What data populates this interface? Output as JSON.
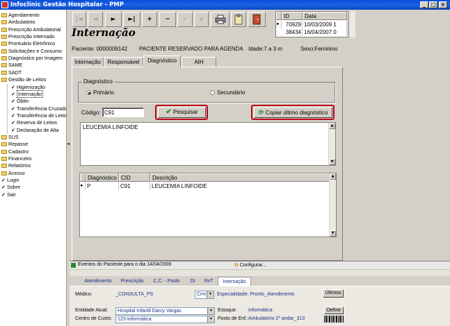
{
  "window": {
    "title": "Infoclinic Gestão Hospitalar - PMP",
    "min": "_",
    "max": "□",
    "close": "×"
  },
  "sidebar": {
    "items": [
      {
        "label": "Agendamento",
        "type": "folder"
      },
      {
        "label": "Ambulatório",
        "type": "folder"
      },
      {
        "label": "Prescrição Ambulatorial",
        "type": "folder"
      },
      {
        "label": "Prescrição Internado",
        "type": "folder"
      },
      {
        "label": "Prontuário Eletrônico",
        "type": "folder"
      },
      {
        "label": "Solicitações e Consumo",
        "type": "folder"
      },
      {
        "label": "Diagnóstico por Imagem",
        "type": "folder"
      },
      {
        "label": "SAME",
        "type": "folder"
      },
      {
        "label": "SADT",
        "type": "folder"
      },
      {
        "label": "Gestão de Leitos",
        "type": "folder-open"
      },
      {
        "label": "Higienização",
        "type": "child"
      },
      {
        "label": "Internação",
        "type": "child-selected"
      },
      {
        "label": "Óbito",
        "type": "child"
      },
      {
        "label": "Transferência Cruzada",
        "type": "child"
      },
      {
        "label": "Transferência de Leito",
        "type": "child"
      },
      {
        "label": "Reserva de Leitos",
        "type": "child"
      },
      {
        "label": "Declaração de Alta",
        "type": "child"
      },
      {
        "label": "SUS",
        "type": "folder"
      },
      {
        "label": "Repasse",
        "type": "folder"
      },
      {
        "label": "Cadastro",
        "type": "folder"
      },
      {
        "label": "Financeiro",
        "type": "folder"
      },
      {
        "label": "Relatórios",
        "type": "folder"
      },
      {
        "label": "Acesso",
        "type": "folder"
      },
      {
        "label": "Login",
        "type": "check"
      },
      {
        "label": "Sobre",
        "type": "check"
      },
      {
        "label": "Sair",
        "type": "check"
      }
    ]
  },
  "toolbar": {
    "first": "|◄",
    "prev": "◄",
    "next": "►",
    "last": "►|",
    "add": "+",
    "remove": "−",
    "confirm": "✓",
    "cancel": "×"
  },
  "record_grid": {
    "headers": [
      "ID",
      "Data"
    ],
    "rows": [
      [
        "70929",
        "10/03/2009 1"
      ],
      [
        "38434",
        "16/04/2007 0"
      ]
    ]
  },
  "page": {
    "title": "Internação",
    "patient_label": "Paciente: 0000009142",
    "patient_name": "PACIENTE RESERVADO PARA AGENDA",
    "age": "Idade:7 a 3 m",
    "sex": "Sexo:Feminino"
  },
  "tabs": [
    "Internação",
    "Responsável",
    "Diagnóstico",
    "AIH"
  ],
  "diagnostico": {
    "group_label": "Diagnóstico",
    "primary": "Primário",
    "secondary": "Secundário",
    "code_label": "Código:",
    "code_value": "C91",
    "search_button": "Pesquisar",
    "copy_button": "Copiar último diagnóstico",
    "memo_text": "LEUCEMIA LINFOIDE",
    "grid_headers": [
      "Diagnóstico",
      "CID",
      "Descrição"
    ],
    "grid_rows": [
      [
        "P",
        "C91",
        "LEUCEMIA LINFOIDE"
      ]
    ]
  },
  "events_bar": {
    "text": "Eventos do Paciente para o dia 14/04/2009",
    "configure": "Configurar..."
  },
  "bottom_tabs": [
    "Atendimento",
    "Prescrição",
    "C.C. - Posto",
    "DI",
    "RxT",
    "Internação"
  ],
  "bottom_panel": {
    "medico_label": "Médico:",
    "medico_value": "_CONSULTA_PS",
    "crm_value": "Crm",
    "especialidade": "Especialidade: Pronto_Atendimento",
    "ultimos": "Últimos",
    "entidade_label": "Entidade Atual:",
    "entidade_value": "Hospital Infantil Darcy Vargas",
    "estoque_label": "Estoque:",
    "estoque_value": "Informática",
    "definir": "Definir",
    "centro_label": "Centro de Custo:",
    "centro_value": "123-Informática",
    "posto_label": "Posto de Enf.:",
    "posto_value": "Ambulatório 2º andar_313"
  }
}
